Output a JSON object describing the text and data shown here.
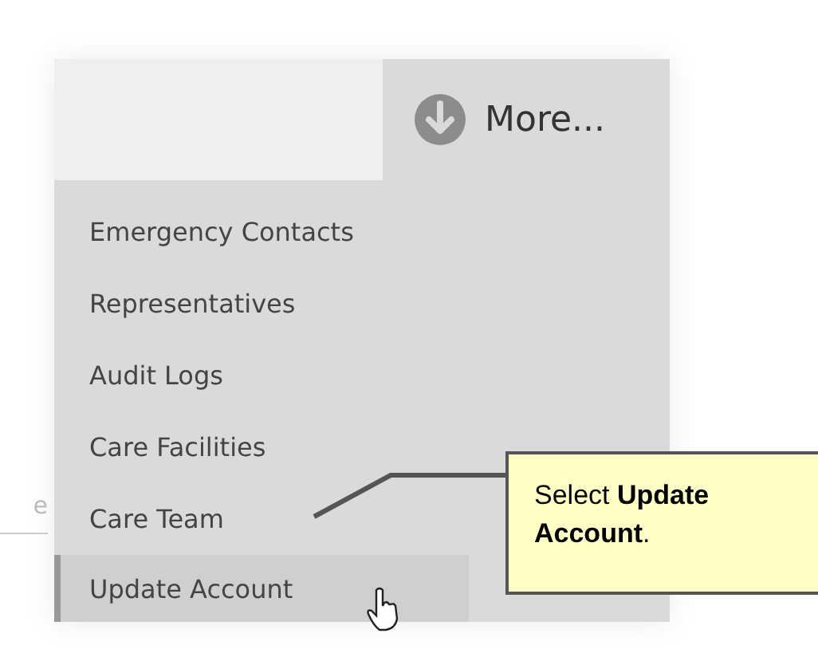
{
  "more_button": {
    "label": "More..."
  },
  "background_field": {
    "text": "e"
  },
  "menu": {
    "items": [
      {
        "label": "Emergency Contacts",
        "selected": false
      },
      {
        "label": "Representatives",
        "selected": false
      },
      {
        "label": "Audit Logs",
        "selected": false
      },
      {
        "label": "Care Facilities",
        "selected": false
      },
      {
        "label": "Care Team",
        "selected": false
      },
      {
        "label": "Update Account",
        "selected": true
      }
    ]
  },
  "callout": {
    "text": "Select **Update Account**."
  }
}
